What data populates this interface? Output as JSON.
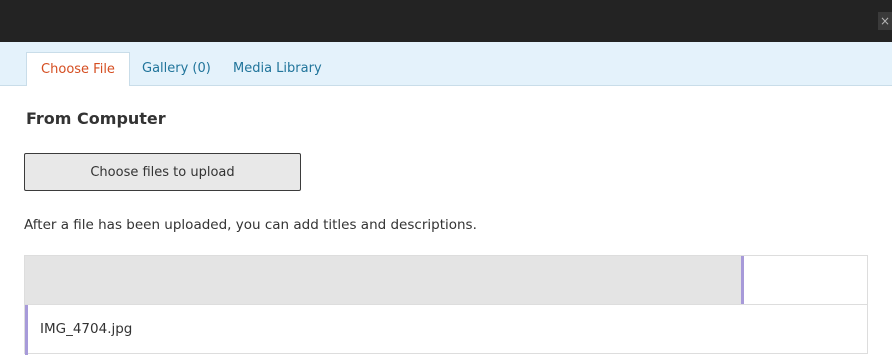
{
  "window": {
    "close_glyph": "×"
  },
  "tabs": [
    {
      "label": "Choose File",
      "active": true
    },
    {
      "label": "Gallery (0)",
      "active": false
    },
    {
      "label": "Media Library",
      "active": false
    }
  ],
  "upload": {
    "heading": "From Computer",
    "button_label": "Choose files to upload",
    "note": "After a file has been uploaded, you can add titles and descriptions."
  },
  "queue": {
    "items": [
      {
        "filename": "IMG_4704.jpg",
        "progress": 0.85
      }
    ]
  },
  "colors": {
    "titlebar": "#232323",
    "tab_bar": "#e4f2fb",
    "active_tab_text": "#d54e21",
    "tab_text": "#21759b",
    "progress_accent": "#a79ad9"
  }
}
